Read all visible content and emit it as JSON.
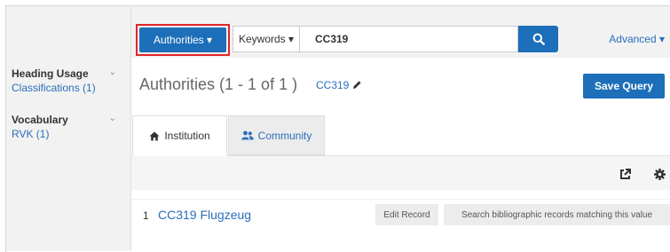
{
  "sidebar": {
    "facets": [
      {
        "heading": "Heading Usage",
        "link": "Classifications (1)"
      },
      {
        "heading": "Vocabulary",
        "link": "RVK (1)"
      }
    ],
    "chevron": "chevron-down-icon"
  },
  "search": {
    "scope_label": "Authorities ▾",
    "field_label": "Keywords ▾",
    "query": "CC319",
    "advanced_label": "Advanced ▾"
  },
  "results": {
    "title": "Authorities (1 - 1 of 1 )",
    "query_label": "CC319",
    "save_query_label": "Save Query"
  },
  "tabs": [
    {
      "label": "Institution",
      "icon": "home-icon",
      "active": true
    },
    {
      "label": "Community",
      "icon": "users-icon",
      "active": false
    }
  ],
  "tools": [
    "export-icon",
    "gear-icon"
  ],
  "rows": [
    {
      "number": "1",
      "title": "CC319 Flugzeug",
      "edit_label": "Edit Record",
      "search_label": "Search bibliographic records matching this value"
    }
  ],
  "colors": {
    "primary": "#1c6fb8",
    "link": "#2a6ebb",
    "highlight": "#e0252c"
  }
}
